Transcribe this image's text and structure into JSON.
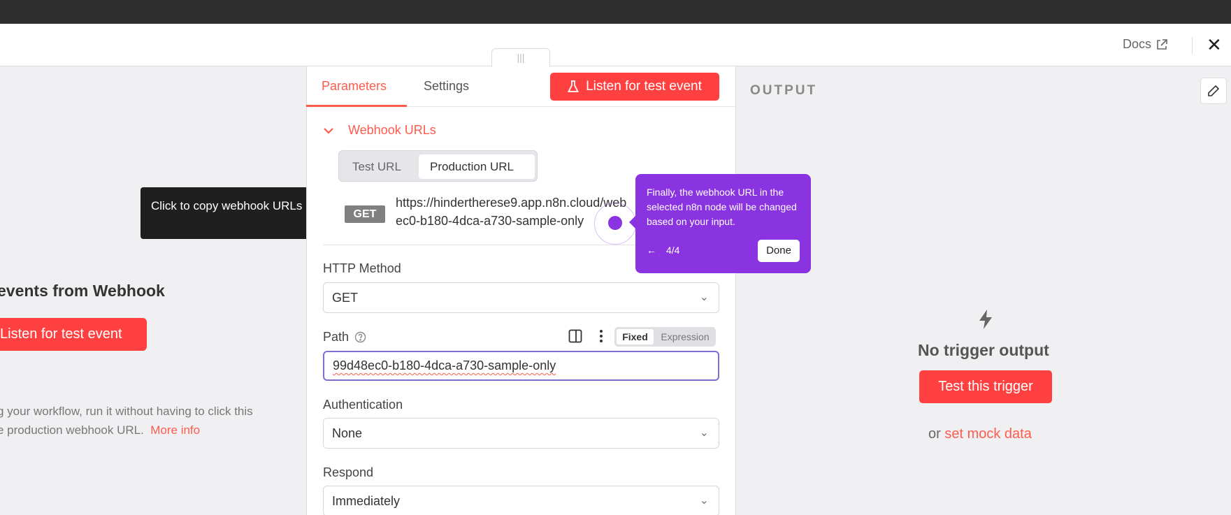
{
  "header": {
    "docs_label": "Docs",
    "close_label": "✕"
  },
  "left": {
    "title": "events from Webhook",
    "listen_label": "Listen for test event",
    "desc_line1": "g your workflow, run it without having to click this",
    "desc_line2": "e production webhook URL.",
    "more_info": "More info"
  },
  "copy_tooltip": "Click to copy webhook URLs",
  "center": {
    "drag_handle": "|||",
    "tabs": [
      {
        "label": "Parameters",
        "active": true
      },
      {
        "label": "Settings",
        "active": false
      }
    ],
    "listen_label": "Listen for test event",
    "section_label": "Webhook URLs",
    "url_toggle": {
      "test": "Test URL",
      "production": "Production URL"
    },
    "method_badge": "GET",
    "url_line1": "https://hindertherese9.app.n8n.cloud/web",
    "url_line2": "ec0-b180-4dca-a730-sample-only",
    "http_method_label": "HTTP Method",
    "http_method_value": "GET",
    "path_label": "Path",
    "path_mode": {
      "fixed": "Fixed",
      "expression": "Expression"
    },
    "path_value": "99d48ec0-b180-4dca-a730-sample-only",
    "auth_label": "Authentication",
    "auth_value": "None",
    "respond_label": "Respond",
    "respond_value": "Immediately"
  },
  "tour": {
    "text": "Finally, the webhook URL in the selected n8n node will be changed based on your input.",
    "back": "←",
    "step": "4/4",
    "done": "Done"
  },
  "right": {
    "output_title": "OUTPUT",
    "no_trigger": "No trigger output",
    "test_trigger": "Test this trigger",
    "or": "or",
    "mock": "set mock data"
  },
  "colors": {
    "accent": "#ff4040",
    "link": "#ff5b4d",
    "tour": "#8a33e0",
    "focus": "#7b6fd6"
  }
}
